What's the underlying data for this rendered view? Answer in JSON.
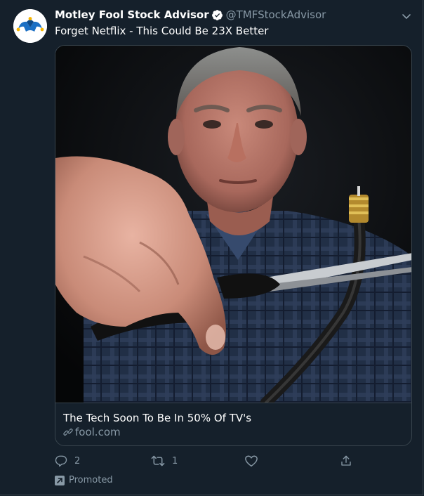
{
  "tweet": {
    "author_name": "Motley Fool Stock Advisor",
    "author_handle": "@TMFStockAdvisor",
    "verified": true,
    "text": "Forget Netflix - This Could Be 23X Better"
  },
  "card": {
    "title": "The Tech Soon To Be In 50% Of TV's",
    "domain": "fool.com",
    "image_description_icon": "photo"
  },
  "actions": {
    "reply_count": "2",
    "retweet_count": "1",
    "like_count": "",
    "share_icon": "share-icon"
  },
  "promoted_label": "Promoted",
  "colors": {
    "background": "#15202b",
    "border": "#38444d",
    "secondary_text": "#8899a6",
    "brand_blue": "#1d9bf0"
  }
}
